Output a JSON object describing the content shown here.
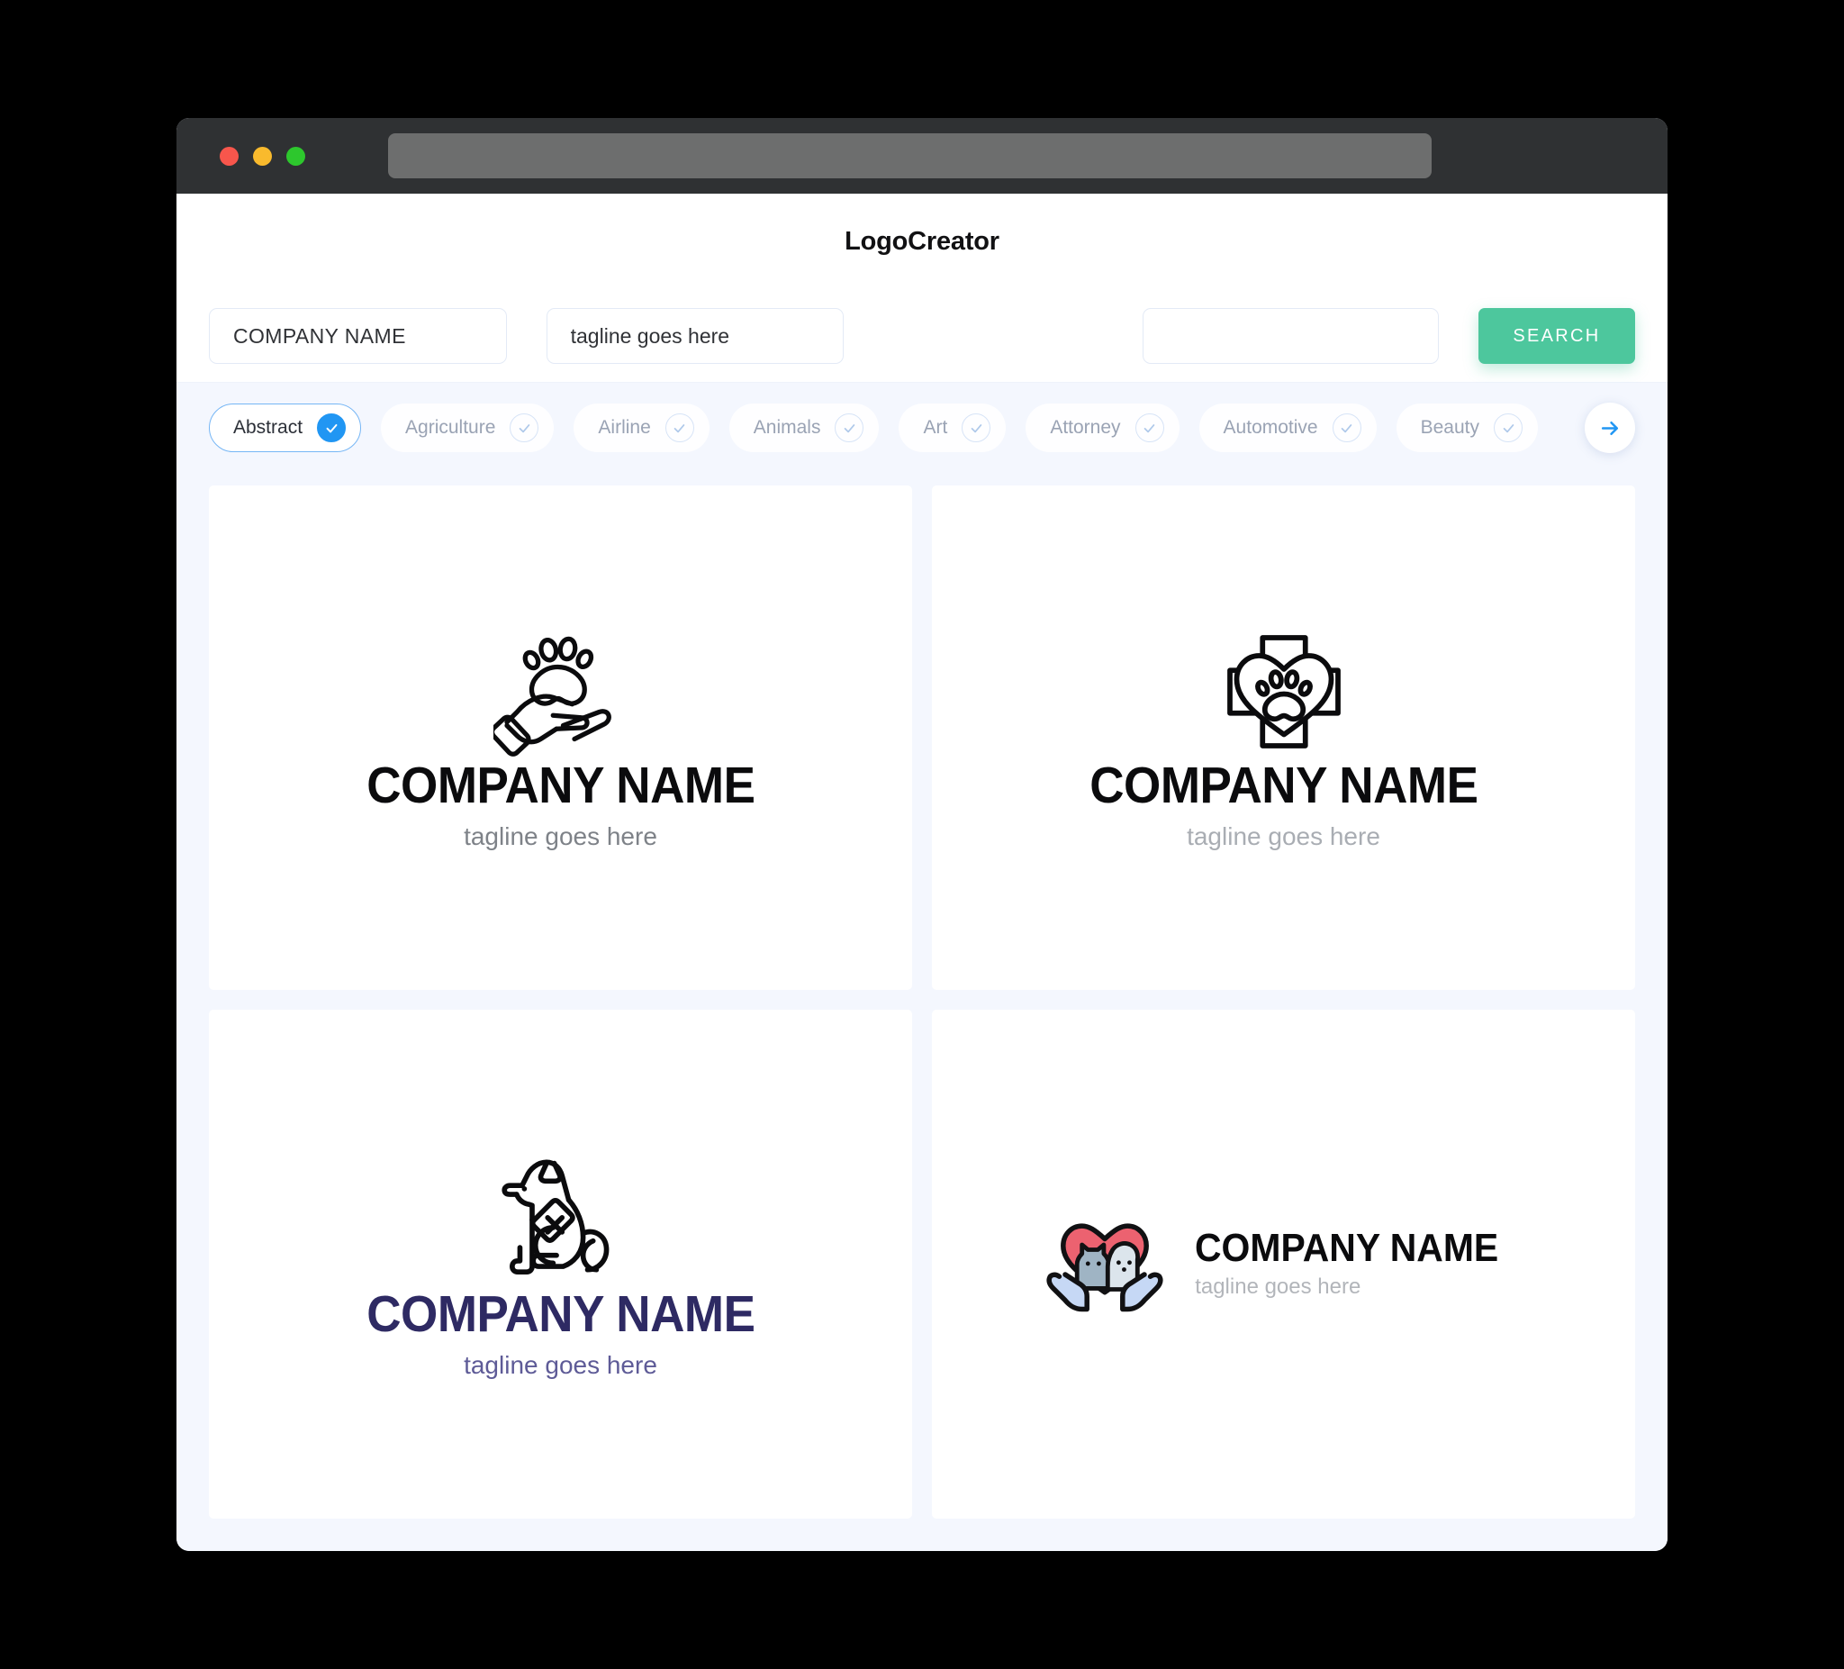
{
  "window": {
    "traffic_lights": [
      "close",
      "minimize",
      "maximize"
    ],
    "url_value": ""
  },
  "header": {
    "title": "LogoCreator"
  },
  "search": {
    "company_value": "COMPANY NAME",
    "company_placeholder": "COMPANY NAME",
    "tagline_value": "tagline goes here",
    "tagline_placeholder": "tagline goes here",
    "extra_value": "",
    "extra_placeholder": "",
    "button_label": "SEARCH",
    "button_color": "#4DC79D"
  },
  "categories": {
    "selected": "Abstract",
    "accent_color": "#2196F3",
    "next_label": "next",
    "items": [
      {
        "label": "Abstract",
        "selected": true
      },
      {
        "label": "Agriculture",
        "selected": false
      },
      {
        "label": "Airline",
        "selected": false
      },
      {
        "label": "Animals",
        "selected": false
      },
      {
        "label": "Art",
        "selected": false
      },
      {
        "label": "Attorney",
        "selected": false
      },
      {
        "label": "Automotive",
        "selected": false
      },
      {
        "label": "Beauty",
        "selected": false
      }
    ]
  },
  "results": [
    {
      "icon": "hand-holding-paw-icon",
      "company_name": "COMPANY NAME",
      "tagline": "tagline goes here",
      "name_color": "#0B0B0D",
      "tagline_color": "#7E8288",
      "layout": "stacked"
    },
    {
      "icon": "cross-heart-paw-icon",
      "company_name": "COMPANY NAME",
      "tagline": "tagline goes here",
      "name_color": "#0B0B0D",
      "tagline_color": "#A9ADB3",
      "layout": "stacked"
    },
    {
      "icon": "service-dog-icon",
      "company_name": "COMPANY NAME",
      "tagline": "tagline goes here",
      "name_color": "#2E2A63",
      "tagline_color": "#5E5B97",
      "layout": "stacked"
    },
    {
      "icon": "hands-heart-pets-icon",
      "company_name": "COMPANY NAME",
      "tagline": "tagline goes here",
      "name_color": "#0B0B0D",
      "tagline_color": "#B2B5BA",
      "layout": "horizontal"
    }
  ]
}
